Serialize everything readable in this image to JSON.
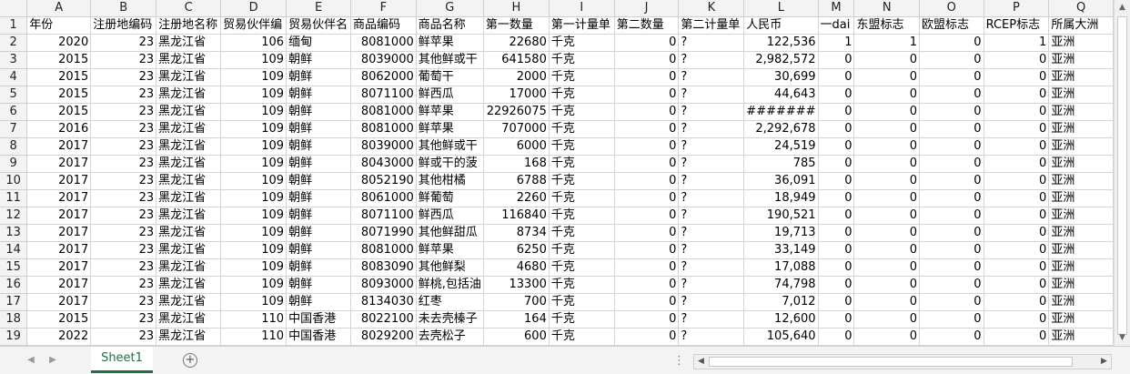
{
  "columns": [
    "A",
    "B",
    "C",
    "D",
    "E",
    "F",
    "G",
    "H",
    "I",
    "J",
    "K",
    "L",
    "M",
    "N",
    "O",
    "P",
    "Q"
  ],
  "rows": [
    [
      "年份",
      "注册地编码",
      "注册地名称",
      "贸易伙伴编",
      "贸易伙伴名",
      "商品编码",
      "商品名称",
      "第一数量",
      "第一计量单",
      "第二数量",
      "第二计量单",
      "人民币",
      "一dai",
      "东盟标志",
      "欧盟标志",
      "RCEP标志",
      "所属大洲"
    ],
    [
      "2020",
      "23",
      "黑龙江省",
      "106",
      "缅甸",
      "8081000",
      "鲜苹果",
      "22680",
      "千克",
      "0",
      "?",
      "122,536",
      "1",
      "1",
      "0",
      "1",
      "亚洲"
    ],
    [
      "2015",
      "23",
      "黑龙江省",
      "109",
      "朝鲜",
      "8039000",
      "其他鲜或干",
      "641580",
      "千克",
      "0",
      "?",
      "2,982,572",
      "0",
      "0",
      "0",
      "0",
      "亚洲"
    ],
    [
      "2015",
      "23",
      "黑龙江省",
      "109",
      "朝鲜",
      "8062000",
      "葡萄干",
      "2000",
      "千克",
      "0",
      "?",
      "30,699",
      "0",
      "0",
      "0",
      "0",
      "亚洲"
    ],
    [
      "2015",
      "23",
      "黑龙江省",
      "109",
      "朝鲜",
      "8071100",
      "鲜西瓜",
      "17000",
      "千克",
      "0",
      "?",
      "44,643",
      "0",
      "0",
      "0",
      "0",
      "亚洲"
    ],
    [
      "2015",
      "23",
      "黑龙江省",
      "109",
      "朝鲜",
      "8081000",
      "鲜苹果",
      "22926075",
      "千克",
      "0",
      "?",
      "#######",
      "0",
      "0",
      "0",
      "0",
      "亚洲"
    ],
    [
      "2016",
      "23",
      "黑龙江省",
      "109",
      "朝鲜",
      "8081000",
      "鲜苹果",
      "707000",
      "千克",
      "0",
      "?",
      "2,292,678",
      "0",
      "0",
      "0",
      "0",
      "亚洲"
    ],
    [
      "2017",
      "23",
      "黑龙江省",
      "109",
      "朝鲜",
      "8039000",
      "其他鲜或干",
      "6000",
      "千克",
      "0",
      "?",
      "24,519",
      "0",
      "0",
      "0",
      "0",
      "亚洲"
    ],
    [
      "2017",
      "23",
      "黑龙江省",
      "109",
      "朝鲜",
      "8043000",
      "鲜或干的菠",
      "168",
      "千克",
      "0",
      "?",
      "785",
      "0",
      "0",
      "0",
      "0",
      "亚洲"
    ],
    [
      "2017",
      "23",
      "黑龙江省",
      "109",
      "朝鲜",
      "8052190",
      "其他柑橘",
      "6788",
      "千克",
      "0",
      "?",
      "36,091",
      "0",
      "0",
      "0",
      "0",
      "亚洲"
    ],
    [
      "2017",
      "23",
      "黑龙江省",
      "109",
      "朝鲜",
      "8061000",
      "鲜葡萄",
      "2260",
      "千克",
      "0",
      "?",
      "18,949",
      "0",
      "0",
      "0",
      "0",
      "亚洲"
    ],
    [
      "2017",
      "23",
      "黑龙江省",
      "109",
      "朝鲜",
      "8071100",
      "鲜西瓜",
      "116840",
      "千克",
      "0",
      "?",
      "190,521",
      "0",
      "0",
      "0",
      "0",
      "亚洲"
    ],
    [
      "2017",
      "23",
      "黑龙江省",
      "109",
      "朝鲜",
      "8071990",
      "其他鲜甜瓜",
      "8734",
      "千克",
      "0",
      "?",
      "19,713",
      "0",
      "0",
      "0",
      "0",
      "亚洲"
    ],
    [
      "2017",
      "23",
      "黑龙江省",
      "109",
      "朝鲜",
      "8081000",
      "鲜苹果",
      "6250",
      "千克",
      "0",
      "?",
      "33,149",
      "0",
      "0",
      "0",
      "0",
      "亚洲"
    ],
    [
      "2017",
      "23",
      "黑龙江省",
      "109",
      "朝鲜",
      "8083090",
      "其他鲜梨",
      "4680",
      "千克",
      "0",
      "?",
      "17,088",
      "0",
      "0",
      "0",
      "0",
      "亚洲"
    ],
    [
      "2017",
      "23",
      "黑龙江省",
      "109",
      "朝鲜",
      "8093000",
      "鲜桃,包括油",
      "13300",
      "千克",
      "0",
      "?",
      "74,798",
      "0",
      "0",
      "0",
      "0",
      "亚洲"
    ],
    [
      "2017",
      "23",
      "黑龙江省",
      "109",
      "朝鲜",
      "8134030",
      "红枣",
      "700",
      "千克",
      "0",
      "?",
      "7,012",
      "0",
      "0",
      "0",
      "0",
      "亚洲"
    ],
    [
      "2015",
      "23",
      "黑龙江省",
      "110",
      "中国香港",
      "8022100",
      "未去壳榛子",
      "164",
      "千克",
      "0",
      "?",
      "12,600",
      "0",
      "0",
      "0",
      "0",
      "亚洲"
    ],
    [
      "2022",
      "23",
      "黑龙江省",
      "110",
      "中国香港",
      "8029200",
      "去壳松子",
      "600",
      "千克",
      "0",
      "?",
      "105,640",
      "0",
      "0",
      "0",
      "0",
      "亚洲"
    ]
  ],
  "sheet_tab": "Sheet1",
  "add_sheet": "+",
  "scroll": {
    "up": "▲",
    "down": "▼",
    "left": "◀",
    "right": "▶",
    "prev": "◀",
    "next": "▶",
    "dots": "⋮"
  }
}
